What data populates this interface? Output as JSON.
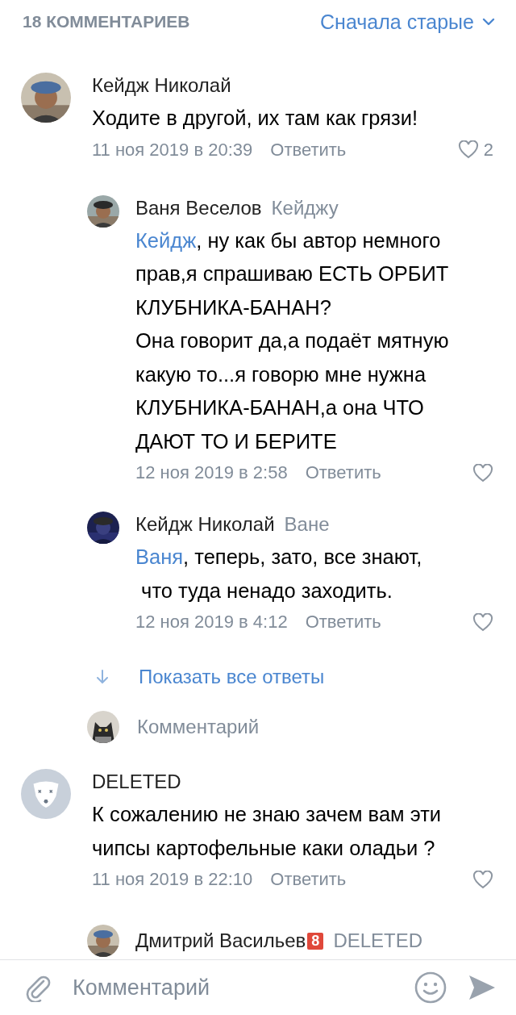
{
  "header": {
    "count": "18 КОММЕНТАРИЕВ",
    "sort": "Сначала старые"
  },
  "thread": [
    {
      "kind": "comment",
      "author": "Кейдж Николай",
      "text": "Ходите в другой, их там как грязи!",
      "date": "11 ноя 2019 в 20:39",
      "reply": "Ответить",
      "likes": "2"
    },
    {
      "kind": "reply",
      "author": "Ваня Веселов",
      "reply_to": "Кейджу",
      "mention": "Кейдж",
      "text": ", ну как бы автор немного прав,я спрашиваю ЕСТЬ ОРБИТ КЛУБНИКА-БАНАН?\nОна говорит да,а подаёт мятную какую то...я говорю мне нужна КЛУБНИКА-БАНАН,а она ЧТО ДАЮТ ТО И БЕРИТЕ",
      "date": "12 ноя 2019 в 2:58",
      "reply": "Ответить"
    },
    {
      "kind": "reply",
      "author": "Кейдж Николай",
      "reply_to": "Ване",
      "mention": "Ваня",
      "text": ", теперь, зато, все знают,\n что туда ненадо заходить.",
      "date": "12 ноя 2019 в 4:12",
      "reply": "Ответить"
    },
    {
      "kind": "more",
      "label": "Показать все ответы"
    },
    {
      "kind": "input",
      "placeholder": "Комментарий"
    },
    {
      "kind": "comment",
      "avatar": {
        "kind": "deleted"
      },
      "author": "DELETED",
      "text": "К сожалению не знаю зачем вам эти чипсы картофельные каки оладьи ?",
      "date": "11 ноя 2019 в 22:10",
      "reply": "Ответить"
    },
    {
      "kind": "reply",
      "author": "Дмитрий Васильев",
      "badge": "8",
      "reply_to": "DELETED"
    }
  ],
  "composer": {
    "placeholder": "Комментарий"
  }
}
